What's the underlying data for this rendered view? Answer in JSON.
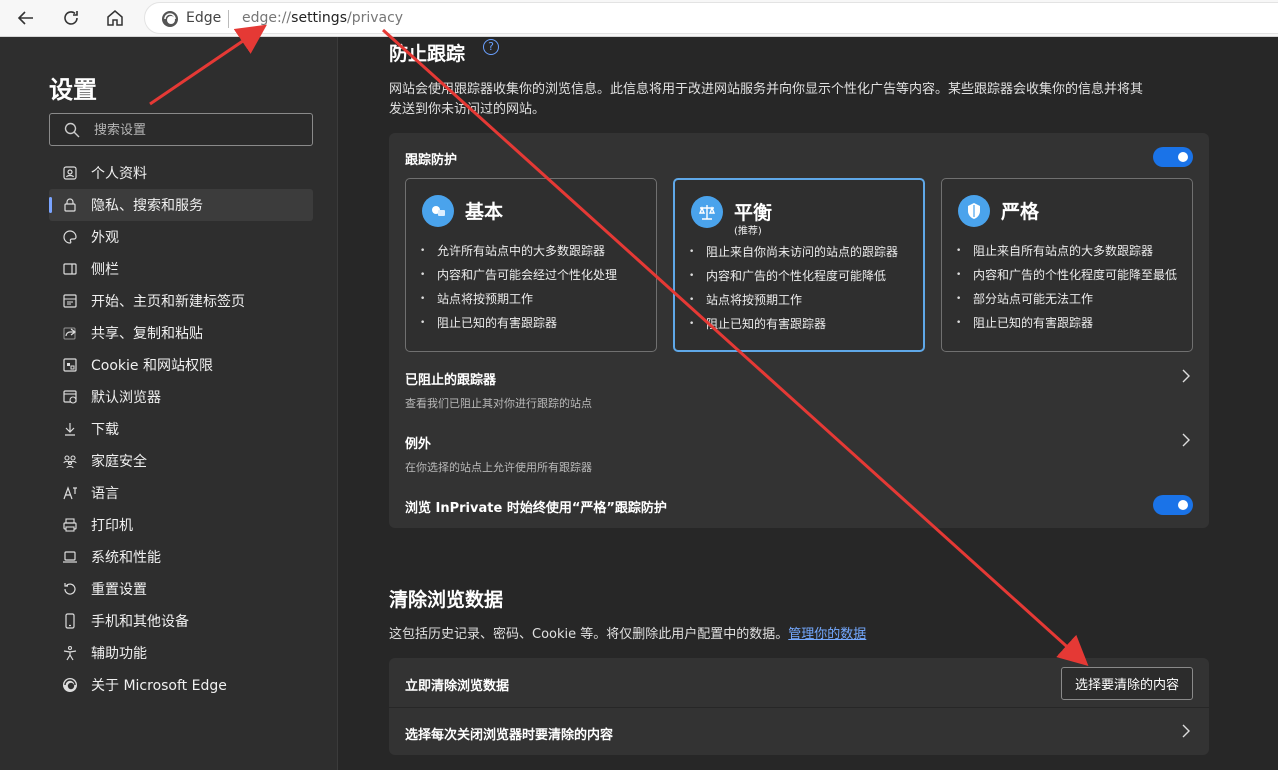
{
  "address_bar": {
    "browser_label": "Edge",
    "url_prefix": "edge://",
    "url_host": "settings",
    "url_path": "/privacy"
  },
  "sidebar": {
    "title": "设置",
    "search_placeholder": "搜索设置",
    "items": [
      {
        "label": "个人资料",
        "icon": "profile-icon"
      },
      {
        "label": "隐私、搜索和服务",
        "icon": "lock-icon",
        "active": true
      },
      {
        "label": "外观",
        "icon": "palette-icon"
      },
      {
        "label": "侧栏",
        "icon": "sidebar-icon"
      },
      {
        "label": "开始、主页和新建标签页",
        "icon": "home-tab-icon"
      },
      {
        "label": "共享、复制和粘贴",
        "icon": "share-icon"
      },
      {
        "label": "Cookie 和网站权限",
        "icon": "cookie-icon"
      },
      {
        "label": "默认浏览器",
        "icon": "browser-icon"
      },
      {
        "label": "下载",
        "icon": "download-icon"
      },
      {
        "label": "家庭安全",
        "icon": "family-icon"
      },
      {
        "label": "语言",
        "icon": "language-icon"
      },
      {
        "label": "打印机",
        "icon": "printer-icon"
      },
      {
        "label": "系统和性能",
        "icon": "laptop-icon"
      },
      {
        "label": "重置设置",
        "icon": "reset-icon"
      },
      {
        "label": "手机和其他设备",
        "icon": "phone-icon"
      },
      {
        "label": "辅助功能",
        "icon": "accessibility-icon"
      },
      {
        "label": "关于 Microsoft Edge",
        "icon": "edge-logo-icon"
      }
    ]
  },
  "tracking": {
    "title": "防止跟踪",
    "description_line1": "网站会使用跟踪器收集你的浏览信息。此信息将用于改进网站服务并向你显示个性化广告等内容。某些跟踪器会收集你的信息并将其",
    "description_line2": "发送到你未访问过的网站。",
    "protection_label": "跟踪防护",
    "levels": [
      {
        "name": "基本",
        "subtitle": "",
        "bullets": [
          "允许所有站点中的大多数跟踪器",
          "内容和广告可能会经过个性化处理",
          "站点将按预期工作",
          "阻止已知的有害跟踪器"
        ]
      },
      {
        "name": "平衡",
        "subtitle": "(推荐)",
        "bullets": [
          "阻止来自你尚未访问的站点的跟踪器",
          "内容和广告的个性化程度可能降低",
          "站点将按预期工作",
          "阻止已知的有害跟踪器"
        ]
      },
      {
        "name": "严格",
        "subtitle": "",
        "bullets": [
          "阻止来自所有站点的大多数跟踪器",
          "内容和广告的个性化程度可能降至最低",
          "部分站点可能无法工作",
          "阻止已知的有害跟踪器"
        ]
      }
    ],
    "blocked_title": "已阻止的跟踪器",
    "blocked_sub": "查看我们已阻止其对你进行跟踪的站点",
    "exceptions_title": "例外",
    "exceptions_sub": "在你选择的站点上允许使用所有跟踪器",
    "inprivate_label": "浏览 InPrivate 时始终使用“严格”跟踪防护"
  },
  "clear": {
    "title": "清除浏览数据",
    "description": "这包括历史记录、密码、Cookie 等。将仅删除此用户配置中的数据。",
    "manage_link": "管理你的数据",
    "clear_now_label": "立即清除浏览数据",
    "choose_button": "选择要清除的内容",
    "on_close_label": "选择每次关闭浏览器时要清除的内容"
  },
  "colors": {
    "accent": "#1a73e8",
    "arrow": "#e53935",
    "selected_border": "#5fa8e8"
  }
}
